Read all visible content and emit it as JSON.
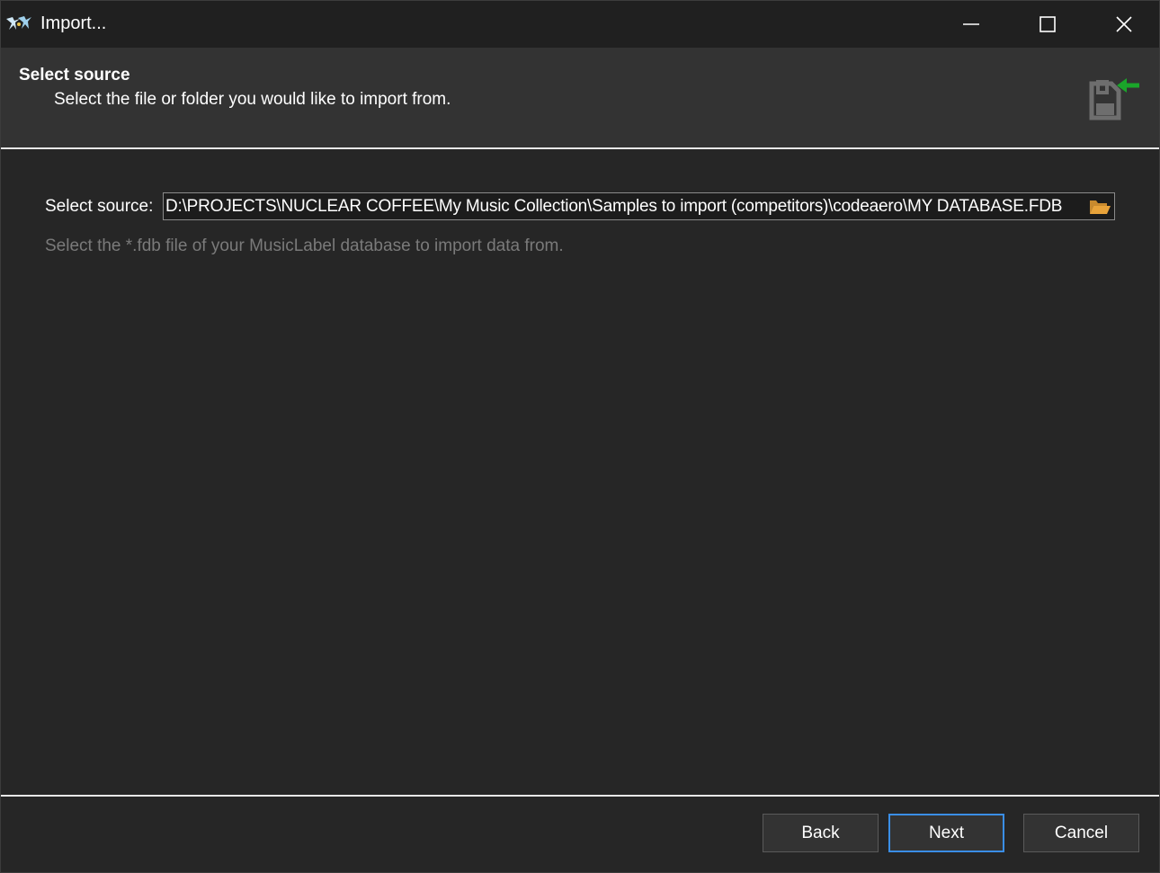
{
  "window": {
    "title": "Import...",
    "controls": {
      "minimize_icon": "minimize-icon",
      "maximize_icon": "maximize-icon",
      "close_icon": "close-icon"
    }
  },
  "header": {
    "title": "Select source",
    "subtitle": "Select the file or folder you would like to import from.",
    "icon": "floppy-import-icon"
  },
  "source": {
    "label": "Select source:",
    "value": "D:\\PROJECTS\\NUCLEAR COFFEE\\My Music Collection\\Samples to import (competitors)\\codeaero\\MY DATABASE.FDB",
    "browse_icon": "folder-open-icon",
    "hint": "Select the *.fdb file of your MusicLabel database to import data from."
  },
  "footer": {
    "back_label": "Back",
    "next_label": "Next",
    "cancel_label": "Cancel"
  },
  "colors": {
    "background": "#262626",
    "titlebar": "#202020",
    "header": "#333333",
    "accent": "#3a8ee6",
    "arrow": "#1aa52a",
    "folder": "#e8a33a",
    "hint_text": "#7a7a7a"
  }
}
